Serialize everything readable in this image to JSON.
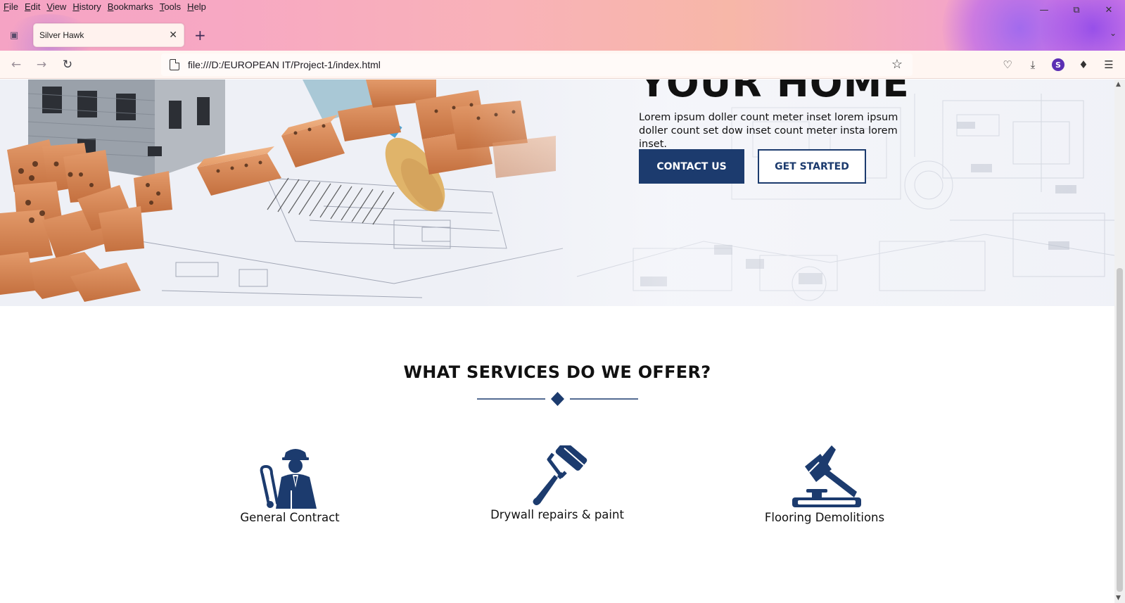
{
  "browser": {
    "menu": [
      "File",
      "Edit",
      "View",
      "History",
      "Bookmarks",
      "Tools",
      "Help"
    ],
    "tab_title": "Silver Hawk",
    "url": "file:///D:/EUROPEAN IT/Project-1/index.html",
    "account_initial": "S",
    "icons": [
      "back-icon",
      "forward-icon",
      "reload-icon",
      "bookmark-star-icon",
      "pocket-icon",
      "downloads-icon",
      "account-icon",
      "extensions-icon",
      "menu-icon"
    ]
  },
  "hero": {
    "title": "YOUR HOME",
    "text": "Lorem ipsum doller count meter inset lorem ipsum doller count set dow inset count meter insta lorem inset.",
    "primary_button": "CONTACT US",
    "secondary_button": "GET STARTED"
  },
  "services": {
    "title": "WHAT SERVICES DO WE OFFER?",
    "items": [
      {
        "label": "General Contract",
        "icon": "contractor-icon"
      },
      {
        "label": "Drywall repairs & paint",
        "icon": "paint-roller-icon"
      },
      {
        "label": "Flooring Demolitions",
        "icon": "hammer-icon"
      }
    ]
  },
  "colors": {
    "brand_navy": "#1c3b6e",
    "text": "#111111"
  }
}
